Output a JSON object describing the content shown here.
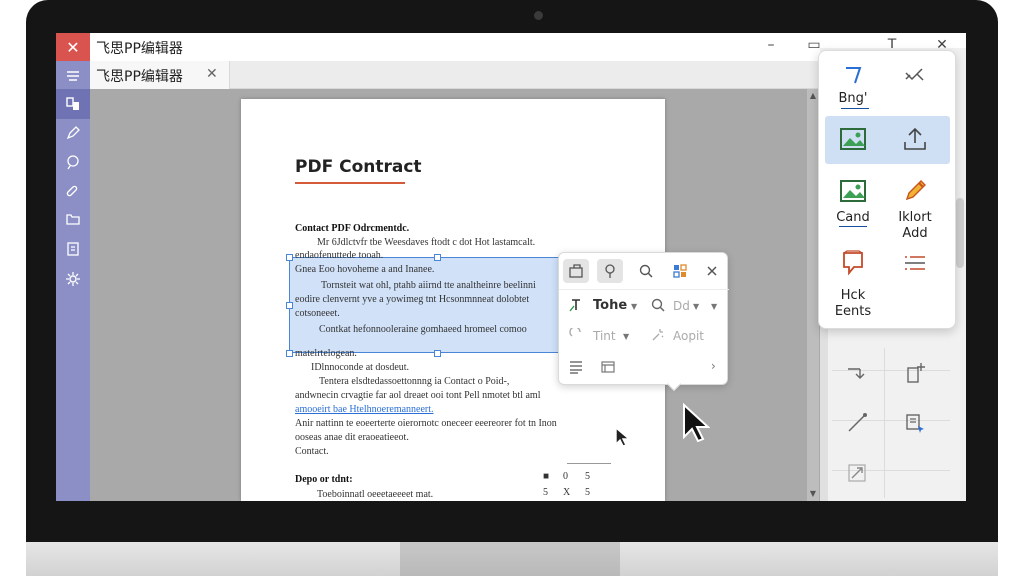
{
  "app": {
    "title": "飞思PP编辑器",
    "close_glyph": "✕",
    "minimize_glyph": "–",
    "restore_glyph": "▭",
    "text_tool_glyph": "T",
    "window_close_glyph": "✕"
  },
  "tabs": [
    {
      "label": "飞思PP编辑器",
      "close_glyph": "✕"
    }
  ],
  "document": {
    "title": "PDF Contract",
    "lines": [
      {
        "text": "Contact PDF Odrcmentdc.",
        "style": "bold"
      },
      {
        "text": "Mr 6Jdlctvfr tbe      Weesdaves ftodt c dot Hot lastamcalt.",
        "style": "normal"
      },
      {
        "text": "endaofenuttede tooah.",
        "style": "normal"
      },
      {
        "text": "Gnea Eoo hovoheme a and Inanee.",
        "style": "normal"
      },
      {
        "text": "Tornsteit wat ohl, ptahb aiirnd tte analtheinre beelinni",
        "style": "normal"
      },
      {
        "text": "eodire clenvernt yve a yowimeg tnt Hcsonmnneat dolobtet",
        "style": "normal"
      },
      {
        "text": "cotsoneeet.",
        "style": "normal"
      },
      {
        "text": "Contkat hefonnooleraine gomhaeed hromeel comoo",
        "style": "normal"
      },
      {
        "text": "matelrtelogean.",
        "style": "normal"
      },
      {
        "text": "IDlnnoconde at dosdeut.",
        "style": "normal"
      },
      {
        "text": "Tentera elsdtedassoettonnng ia Contact o Poid-,",
        "style": "normal"
      },
      {
        "text": "andwnecin crvagtie far aol dreaet ooi tont Pell nmotet btl aml",
        "style": "normal"
      },
      {
        "text": "amooeirt bae Htelhnoeremanneert.",
        "style": "link-tail"
      },
      {
        "text": "Anir nattinn te eoeerterte oierornotc oneceer eeereorer fot tn Inon",
        "style": "normal"
      },
      {
        "text": "ooseas anae dit eraoeatieeot.",
        "style": "normal"
      },
      {
        "text": "Contact.",
        "style": "normal"
      },
      {
        "text": "Depo or tdnt:",
        "style": "bold"
      },
      {
        "text": "Toeboinnatl oeeetaeeeet mat.",
        "style": "normal"
      }
    ],
    "mini_table": [
      {
        "a": "■",
        "b": "0",
        "c": "5"
      },
      {
        "a": "5",
        "b": "X",
        "c": "5"
      }
    ]
  },
  "float_toolbar": {
    "row1": [
      "frame-icon",
      "pin-icon",
      "search-icon",
      "grid-icon",
      "close-icon"
    ],
    "font_label": "Tohe",
    "size_label": "Dd",
    "tint_label": "Tint",
    "apply_label": "Aopit",
    "more_glyph": "›"
  },
  "right_popover": {
    "items": [
      {
        "label": "Bng'",
        "icon": "text-style-icon"
      },
      {
        "label": "",
        "icon": "scissors-icon"
      },
      {
        "label": "",
        "icon": "image-icon"
      },
      {
        "label": "",
        "icon": "upload-icon"
      },
      {
        "label": "Cand",
        "icon": "image-add-icon"
      },
      {
        "label": "Iklort Add",
        "icon": "pencil-icon"
      },
      {
        "label": "Hck Eents",
        "icon": "comment-icon"
      },
      {
        "label": "",
        "icon": "list-icon"
      }
    ]
  },
  "colors": {
    "sidebar": "#8b8fc6",
    "accent_blue": "#4a86d8",
    "highlight": "#cfe0f5",
    "title_underline": "#d45a3a",
    "close_red": "#d9534f"
  }
}
